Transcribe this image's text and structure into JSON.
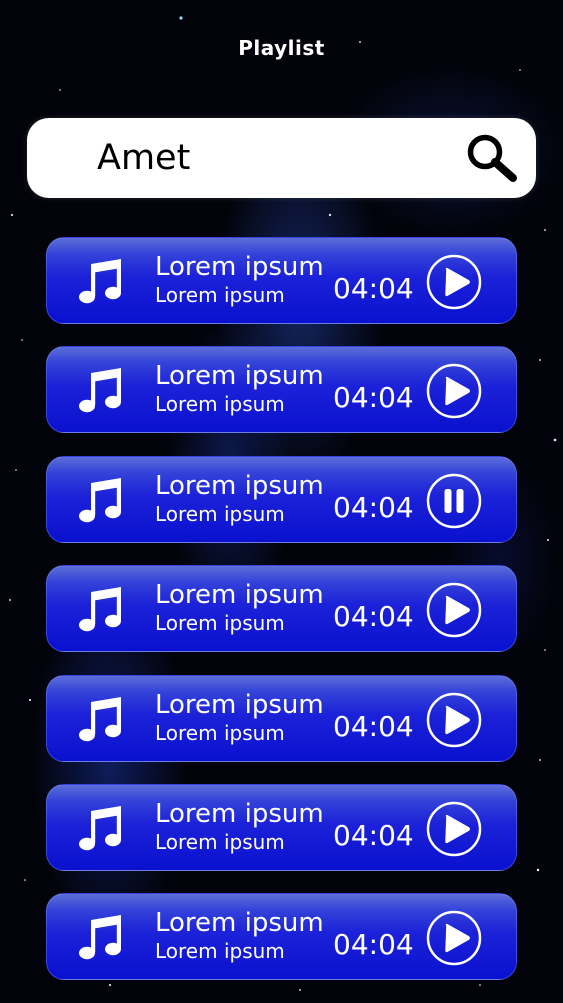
{
  "header": {
    "title": "Playlist"
  },
  "search": {
    "value": "Amet",
    "icon": "search-icon"
  },
  "colors": {
    "background": "#02030a",
    "track_gradient_top": "#5d6ed8",
    "track_gradient_bottom": "#0a11cf",
    "text": "#ffffff",
    "search_bg": "#ffffff"
  },
  "tracks": [
    {
      "title": "Lorem ipsum",
      "subtitle": "Lorem ipsum",
      "duration": "04:04",
      "state": "play"
    },
    {
      "title": "Lorem ipsum",
      "subtitle": "Lorem ipsum",
      "duration": "04:04",
      "state": "play"
    },
    {
      "title": "Lorem ipsum",
      "subtitle": "Lorem ipsum",
      "duration": "04:04",
      "state": "pause"
    },
    {
      "title": "Lorem ipsum",
      "subtitle": "Lorem ipsum",
      "duration": "04:04",
      "state": "play"
    },
    {
      "title": "Lorem ipsum",
      "subtitle": "Lorem ipsum",
      "duration": "04:04",
      "state": "play"
    },
    {
      "title": "Lorem ipsum",
      "subtitle": "Lorem ipsum",
      "duration": "04:04",
      "state": "play"
    },
    {
      "title": "Lorem ipsum",
      "subtitle": "Lorem ipsum",
      "duration": "04:04",
      "state": "play"
    }
  ]
}
